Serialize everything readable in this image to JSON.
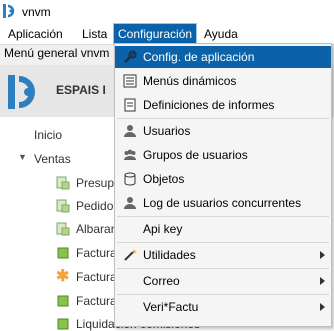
{
  "window": {
    "title": "vnvm"
  },
  "menubar": {
    "items": [
      "Aplicación",
      "Lista",
      "Configuración",
      "Ayuda"
    ]
  },
  "toolbar": {
    "tab_label": "Menú general vnvm"
  },
  "header": {
    "brand": "ESPAIS I"
  },
  "tree": {
    "inicio": "Inicio",
    "ventas": "Ventas",
    "children": [
      "Presup",
      "Pedido",
      "Albaran",
      "Factura",
      "Factura",
      "Factura",
      "Liquidación comisiones"
    ]
  },
  "dropdown": {
    "items": [
      {
        "label": "Config. de aplicación",
        "icon": "wrench-icon"
      },
      {
        "label": "Menús dinámicos",
        "icon": "menu-list-icon"
      },
      {
        "label": "Definiciones de informes",
        "icon": "report-icon"
      },
      {
        "label": "Usuarios",
        "icon": "user-icon"
      },
      {
        "label": "Grupos de usuarios",
        "icon": "users-group-icon"
      },
      {
        "label": "Objetos",
        "icon": "cylinder-icon"
      },
      {
        "label": "Log de usuarios concurrentes",
        "icon": "user-log-icon"
      },
      {
        "label": "Api key",
        "icon": ""
      },
      {
        "label": "Utilidades",
        "icon": "magic-wand-icon"
      },
      {
        "label": "Correo",
        "icon": ""
      },
      {
        "label": "Veri*Factu",
        "icon": ""
      }
    ]
  },
  "colors": {
    "highlight": "#0b62a9",
    "brand_blue": "#2e7fc0"
  }
}
